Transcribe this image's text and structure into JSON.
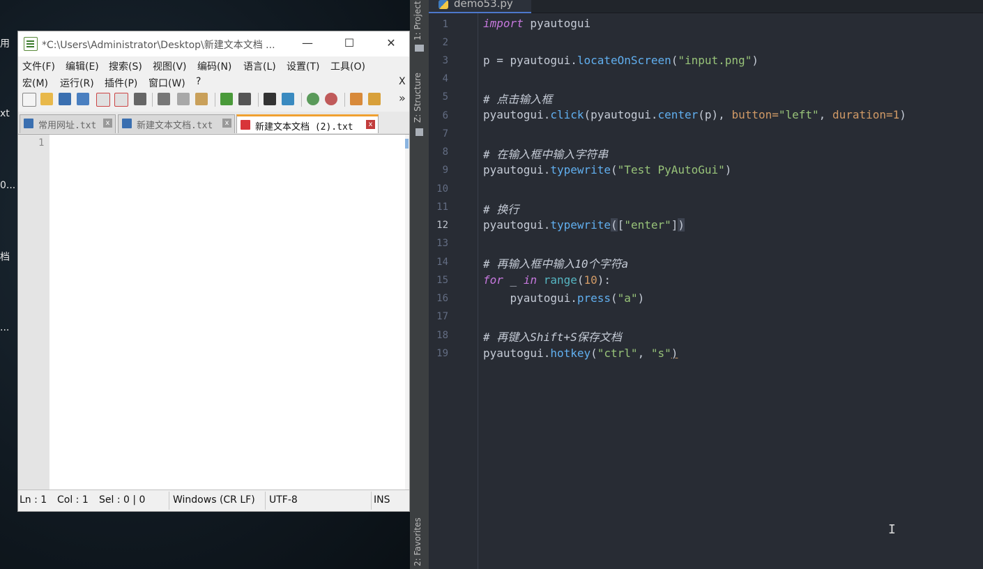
{
  "desktop": {
    "fragments": [
      "用",
      "xt",
      "0...",
      "档",
      "..."
    ]
  },
  "notepad": {
    "title": "*C:\\Users\\Administrator\\Desktop\\新建文本文档 ...",
    "window_buttons": {
      "minimize": "—",
      "maximize": "☐",
      "close": "✕"
    },
    "menu_row1": [
      "文件(F)",
      "编辑(E)",
      "搜索(S)",
      "视图(V)",
      "编码(N)",
      "语言(L)",
      "设置(T)",
      "工具(O)"
    ],
    "menu_row2": [
      "宏(M)",
      "运行(R)",
      "插件(P)",
      "窗口(W)",
      "?"
    ],
    "menu_close": "X",
    "toolbar_overflow": "»",
    "tabs": [
      {
        "label": "常用网址.txt",
        "active": false
      },
      {
        "label": "新建文本文档.txt",
        "active": false
      },
      {
        "label": "新建文本文档 (2).txt",
        "active": true
      }
    ],
    "tab_close": "x",
    "editor_line": "1",
    "status": {
      "ln": "Ln : 1",
      "col": "Col : 1",
      "sel": "Sel : 0 | 0",
      "eol": "Windows (CR LF)",
      "encoding": "UTF-8",
      "mode": "INS"
    }
  },
  "ide": {
    "side_labels": {
      "project": "1: Project",
      "structure": "Z: Structure",
      "favorites": "2: Favorites"
    },
    "file_tab": "demo53.py",
    "current_line": 12,
    "line_numbers": [
      "1",
      "2",
      "3",
      "4",
      "5",
      "6",
      "7",
      "8",
      "9",
      "10",
      "11",
      "12",
      "13",
      "14",
      "15",
      "16",
      "17",
      "18",
      "19"
    ],
    "code": {
      "l1_kw": "import",
      "l1_rest": " pyautogui",
      "l3_a": "p = pyautogui.",
      "l3_fn": "locateOnScreen",
      "l3_b": "(",
      "l3_str": "\"input.png\"",
      "l3_c": ")",
      "l5_cmt": "# 点击输入框",
      "l6_a": "pyautogui.",
      "l6_fn1": "click",
      "l6_b": "(pyautogui.",
      "l6_fn2": "center",
      "l6_c": "(p), ",
      "l6_p1": "button",
      "l6_eq1": "=",
      "l6_s1": "\"left\"",
      "l6_d": ", ",
      "l6_p2": "duration",
      "l6_eq2": "=",
      "l6_n": "1",
      "l6_e": ")",
      "l8_cmt": "# 在输入框中输入字符串",
      "l9_a": "pyautogui.",
      "l9_fn": "typewrite",
      "l9_b": "(",
      "l9_str": "\"Test PyAutoGui\"",
      "l9_c": ")",
      "l11_cmt": "# 换行",
      "l12_a": "pyautogui.",
      "l12_fn": "typewrite",
      "l12_b": "(",
      "l12_c": "[",
      "l12_str": "\"enter\"",
      "l12_d": "]",
      "l12_e": ")",
      "l14_cmt": "# 再输入框中输入10个字符a",
      "l15_kw1": "for",
      "l15_a": " _ ",
      "l15_kw2": "in",
      "l15_b": " ",
      "l15_bi": "range",
      "l15_c": "(",
      "l15_n": "10",
      "l15_d": "):",
      "l16_a": "    pyautogui.",
      "l16_fn": "press",
      "l16_b": "(",
      "l16_str": "\"a\"",
      "l16_c": ")",
      "l18_cmt": "# 再键入Shift+S保存文档",
      "l19_a": "pyautogui.",
      "l19_fn": "hotkey",
      "l19_b": "(",
      "l19_s1": "\"ctrl\"",
      "l19_c": ", ",
      "l19_s2": "\"s\"",
      "l19_d": ")"
    },
    "cursor_glyph": "I"
  }
}
